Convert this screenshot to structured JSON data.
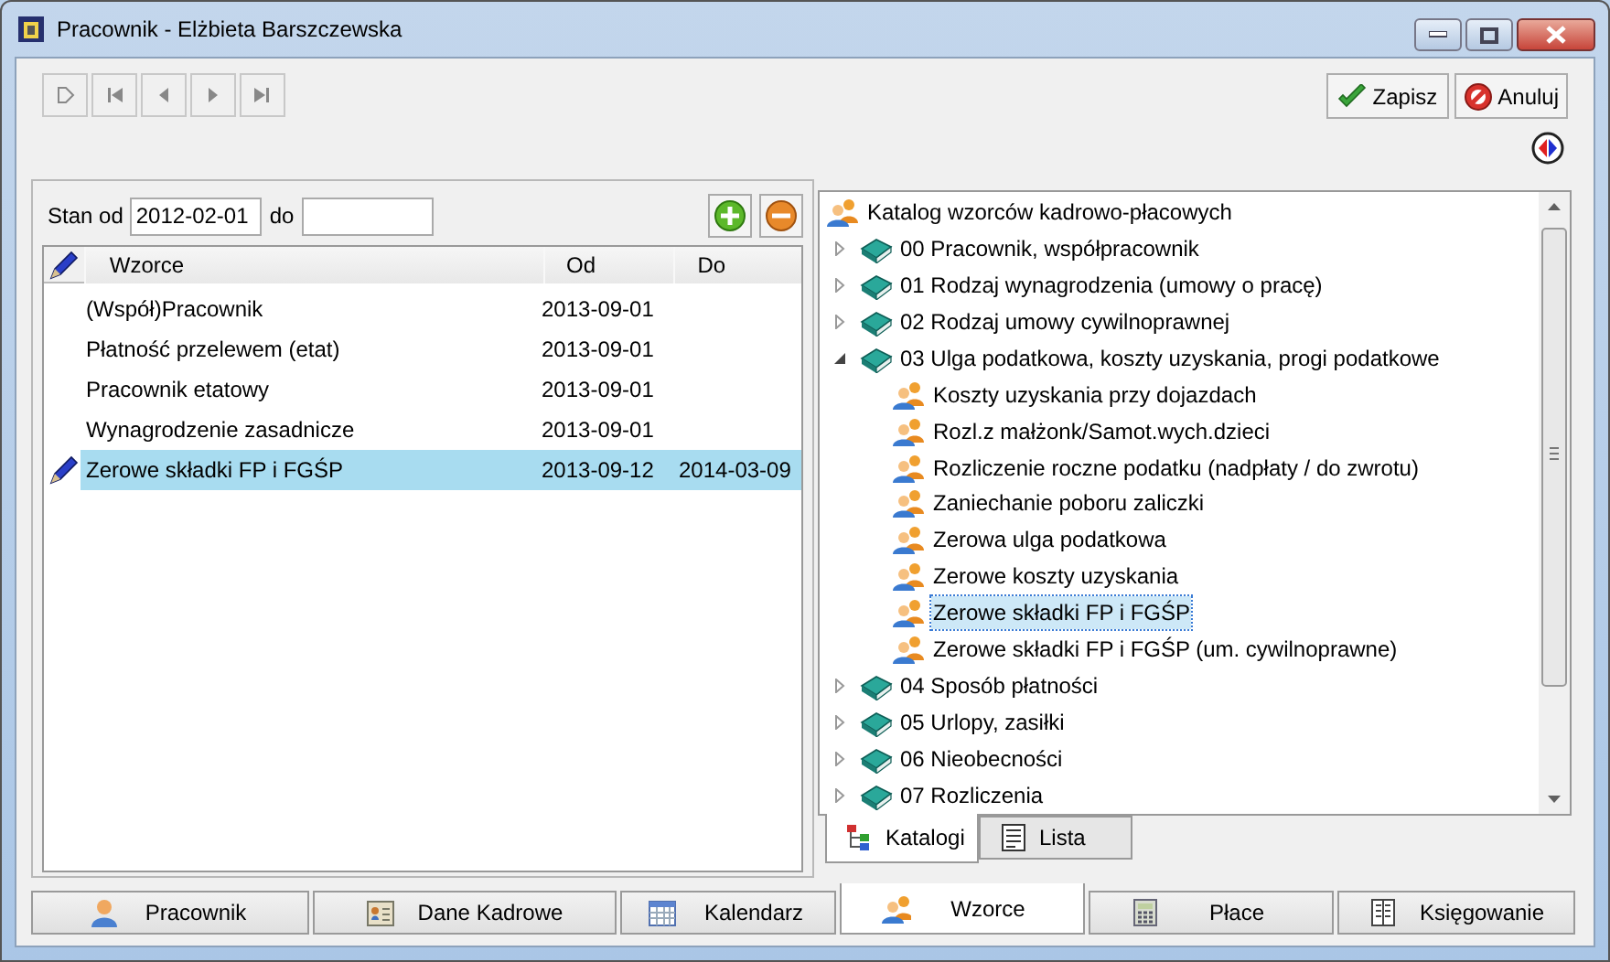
{
  "window": {
    "title": "Pracownik - Elżbieta Barszczewska"
  },
  "toolbar": {
    "nav_buttons": [
      {
        "kind": "new"
      },
      {
        "kind": "first"
      },
      {
        "kind": "prev"
      },
      {
        "kind": "next"
      },
      {
        "kind": "last"
      }
    ],
    "save": "Zapisz",
    "cancel": "Anuluj"
  },
  "filter": {
    "from_label": "Stan od",
    "from_value": "2012-02-01",
    "to_label": "do"
  },
  "table": {
    "columns": [
      "Wzorce",
      "Od",
      "Do"
    ],
    "rows": [
      {
        "name": "(Współ)Pracownik",
        "od": "2013-09-01",
        "selected": false
      },
      {
        "name": "Płatność przelewem (etat)",
        "od": "2013-09-01",
        "selected": false
      },
      {
        "name": "Pracownik etatowy",
        "od": "2013-09-01",
        "selected": false
      },
      {
        "name": "Wynagrodzenie zasadnicze",
        "od": "2013-09-01",
        "selected": false
      },
      {
        "name": "Zerowe składki FP i FGŚP",
        "od": "2013-09-12",
        "do": "2014-03-09",
        "selected": true
      }
    ]
  },
  "tree": {
    "root": "Katalog wzorców kadrowo-płacowych",
    "items": [
      {
        "label": "00 Pracownik, współpracownik",
        "expanded": false
      },
      {
        "label": "01 Rodzaj wynagrodzenia (umowy o pracę)",
        "expanded": false
      },
      {
        "label": "02 Rodzaj umowy cywilnoprawnej",
        "expanded": false
      },
      {
        "label": "03 Ulga podatkowa, koszty uzyskania, progi podatkowe",
        "expanded": true,
        "children": [
          {
            "label": "Koszty uzyskania przy dojazdach",
            "selected": false
          },
          {
            "label": "Rozl.z małżonk/Samot.wych.dzieci",
            "selected": false
          },
          {
            "label": "Rozliczenie roczne podatku (nadpłaty / do zwrotu)",
            "selected": false
          },
          {
            "label": "Zaniechanie poboru zaliczki",
            "selected": false
          },
          {
            "label": "Zerowa ulga podatkowa",
            "selected": false
          },
          {
            "label": "Zerowe koszty uzyskania",
            "selected": false
          },
          {
            "label": "Zerowe składki FP i FGŚP",
            "selected": true
          },
          {
            "label": "Zerowe składki FP i FGŚP (um. cywilnoprawne)",
            "selected": false
          }
        ]
      },
      {
        "label": "04 Sposób płatności",
        "expanded": false
      },
      {
        "label": "05 Urlopy, zasiłki",
        "expanded": false
      },
      {
        "label": "06 Nieobecności",
        "expanded": false
      },
      {
        "label": "07 Rozliczenia",
        "expanded": false
      }
    ]
  },
  "tree_tabs": [
    {
      "label": "Katalogi",
      "kind": "tree",
      "selected": true
    },
    {
      "label": "Lista",
      "kind": "list",
      "selected": false
    }
  ],
  "bottom_tabs": [
    {
      "label": "Pracownik",
      "kind": "person",
      "selected": false
    },
    {
      "label": "Dane Kadrowe",
      "kind": "card",
      "selected": false
    },
    {
      "label": "Kalendarz",
      "kind": "calendar",
      "selected": false
    },
    {
      "label": "Wzorce",
      "kind": "people",
      "selected": true
    },
    {
      "label": "Płace",
      "kind": "calculator",
      "selected": false
    },
    {
      "label": "Księgowanie",
      "kind": "ledger",
      "selected": false
    }
  ]
}
